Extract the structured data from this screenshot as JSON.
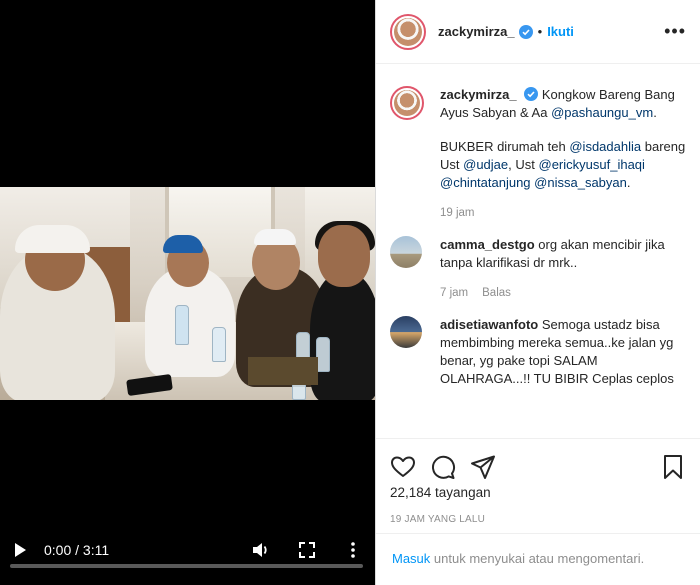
{
  "video": {
    "time_current": "0:00",
    "time_separator": "/",
    "time_total": "3:11",
    "progress_fraction": 0
  },
  "header": {
    "username": "zackymirza_",
    "dot": "•",
    "follow_label": "Ikuti",
    "more_label": "•••"
  },
  "caption": {
    "username": "zackymirza_",
    "text_1": "Kongkow Bareng Bang Ayus Sabyan & Aa",
    "mention_1": "@pashaungu_vm",
    "text_2": ".",
    "text_3": "BUKBER dirumah teh",
    "mention_2": "@isdadahlia",
    "text_4": "bareng Ust",
    "mention_3": "@udjae",
    "text_5": ", Ust",
    "mention_4": "@erickyusuf_ihaqi",
    "mention_5": "@chintatanjung",
    "mention_6": "@nissa_sabyan",
    "text_6": ".",
    "time": "19 jam"
  },
  "comments": [
    {
      "username": "camma_destgo",
      "text": "org akan mencibir jika tanpa klarifikasi dr mrk..",
      "time": "7 jam",
      "reply_label": "Balas"
    },
    {
      "username": "adisetiawanfoto",
      "text": "Semoga ustadz bisa membimbing mereka semua..ke jalan yg benar, yg pake topi SALAM OLAHRAGA...!! TU BIBIR Ceplas ceplos"
    }
  ],
  "stats": {
    "views": "22,184 tayangan",
    "posted_ago": "19 JAM YANG LALU"
  },
  "login_bar": {
    "link": "Masuk",
    "text": " untuk menyukai atau mengomentari."
  },
  "colors": {
    "accent": "#0095f6",
    "mention": "#00376b",
    "muted": "#8e8e8e",
    "verified": "#3897f0"
  },
  "icons": [
    "play-icon",
    "volume-icon",
    "fullscreen-icon",
    "video-more-icon",
    "verified-icon",
    "heart-icon",
    "comment-icon",
    "share-icon",
    "bookmark-icon"
  ]
}
